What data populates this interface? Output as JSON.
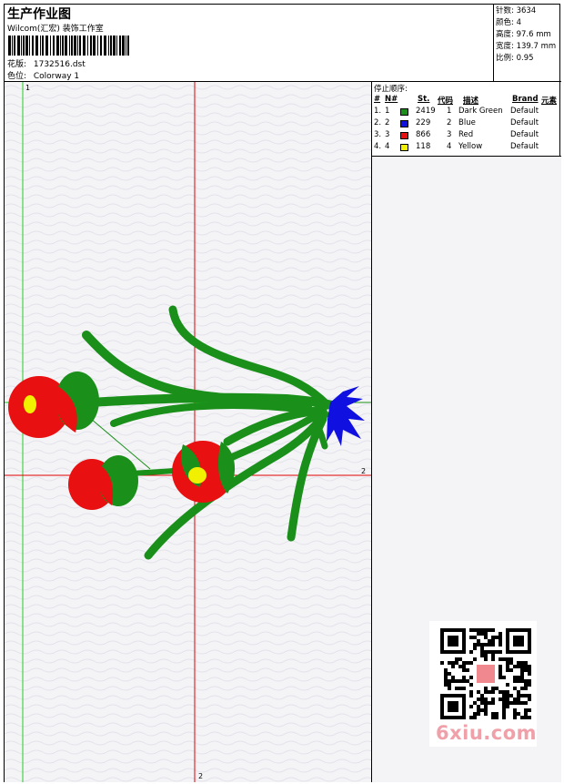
{
  "header": {
    "title": "生产作业图",
    "subtitle": "Wilcom(汇宏) 装饰工作室",
    "design_label": "花版:",
    "design_value": "1732516.dst",
    "colorway_label": "色位:",
    "colorway_value": "Colorway 1"
  },
  "stats": [
    {
      "label": "针数:",
      "value": "3634"
    },
    {
      "label": "颜色:",
      "value": "4"
    },
    {
      "label": "高度:",
      "value": "97.6 mm"
    },
    {
      "label": "宽度:",
      "value": "139.7 mm"
    },
    {
      "label": "比例:",
      "value": "0.95"
    }
  ],
  "color_table": {
    "title": "停止顺序:",
    "headers": {
      "idx": "#",
      "no": "N#",
      "st": "St.",
      "code": "代码",
      "desc": "描述",
      "brand": "Brand",
      "elem": "元素"
    },
    "rows": [
      {
        "idx": "1.",
        "no": "1",
        "color": "#1a8f1a",
        "st": "2419",
        "code": "1",
        "desc": "Dark Green",
        "brand": "Default"
      },
      {
        "idx": "2.",
        "no": "2",
        "color": "#1010e0",
        "st": "229",
        "code": "2",
        "desc": "Blue",
        "brand": "Default"
      },
      {
        "idx": "3.",
        "no": "3",
        "color": "#e81010",
        "st": "866",
        "code": "3",
        "desc": "Red",
        "brand": "Default"
      },
      {
        "idx": "4.",
        "no": "4",
        "color": "#f0f000",
        "st": "118",
        "code": "4",
        "desc": "Yellow",
        "brand": "Default"
      }
    ]
  },
  "canvas": {
    "marker_green": "1",
    "marker_red_bottom": "2",
    "marker_red_right": "2"
  },
  "watermark": {
    "site": "6xiu.com"
  },
  "colors": {
    "green": "#1a8f1a",
    "blue": "#1010e0",
    "red": "#e81010",
    "yellow": "#f0f000",
    "guide_green": "#22cc22",
    "guide_red": "#e00000"
  }
}
